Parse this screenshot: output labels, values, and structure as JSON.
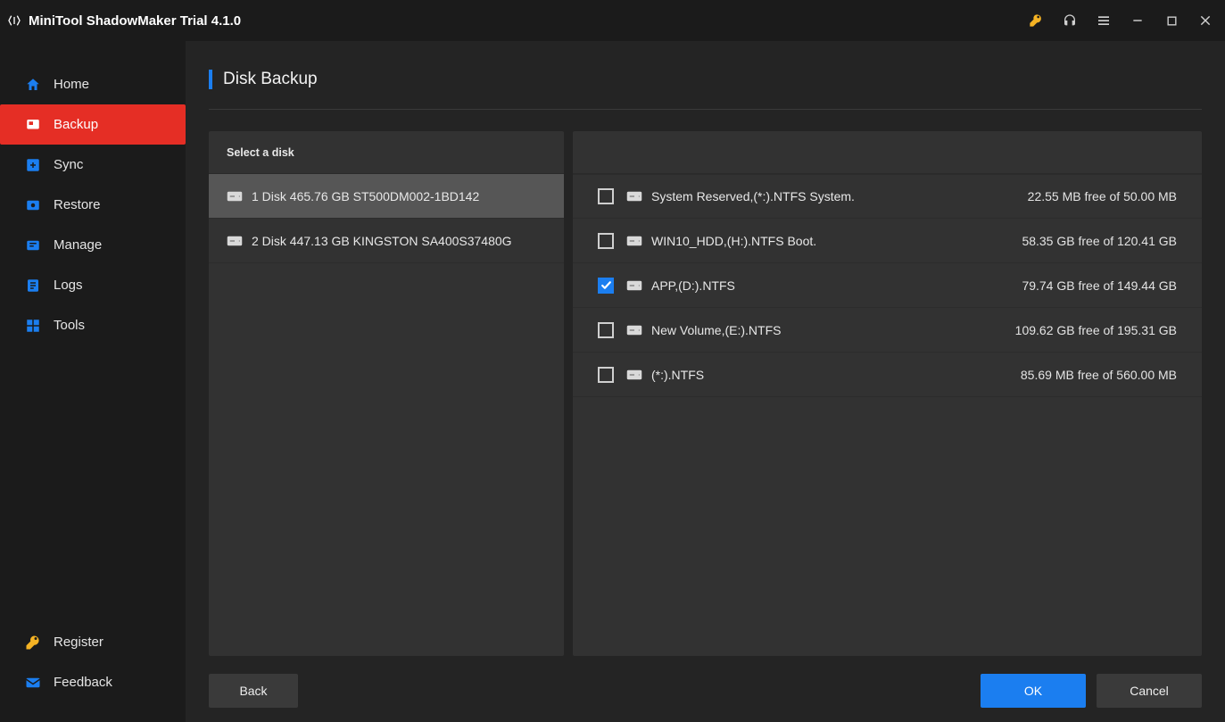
{
  "app": {
    "title": "MiniTool ShadowMaker Trial 4.1.0"
  },
  "sidebar": {
    "items": [
      {
        "label": "Home"
      },
      {
        "label": "Backup"
      },
      {
        "label": "Sync"
      },
      {
        "label": "Restore"
      },
      {
        "label": "Manage"
      },
      {
        "label": "Logs"
      },
      {
        "label": "Tools"
      }
    ],
    "bottom": [
      {
        "label": "Register"
      },
      {
        "label": "Feedback"
      }
    ]
  },
  "page": {
    "title": "Disk Backup",
    "left_header": "Select a disk"
  },
  "disks": [
    {
      "label": "1 Disk 465.76 GB ST500DM002-1BD142",
      "selected": true
    },
    {
      "label": "2 Disk 447.13 GB KINGSTON SA400S37480G",
      "selected": false
    }
  ],
  "partitions": [
    {
      "name": "System Reserved,(*:).NTFS System.",
      "free": "22.55 MB free of 50.00 MB",
      "checked": false
    },
    {
      "name": "WIN10_HDD,(H:).NTFS Boot.",
      "free": "58.35 GB free of 120.41 GB",
      "checked": false
    },
    {
      "name": "APP,(D:).NTFS",
      "free": "79.74 GB free of 149.44 GB",
      "checked": true
    },
    {
      "name": "New Volume,(E:).NTFS",
      "free": "109.62 GB free of 195.31 GB",
      "checked": false
    },
    {
      "name": "(*:).NTFS",
      "free": "85.69 MB free of 560.00 MB",
      "checked": false
    }
  ],
  "buttons": {
    "back": "Back",
    "ok": "OK",
    "cancel": "Cancel"
  }
}
